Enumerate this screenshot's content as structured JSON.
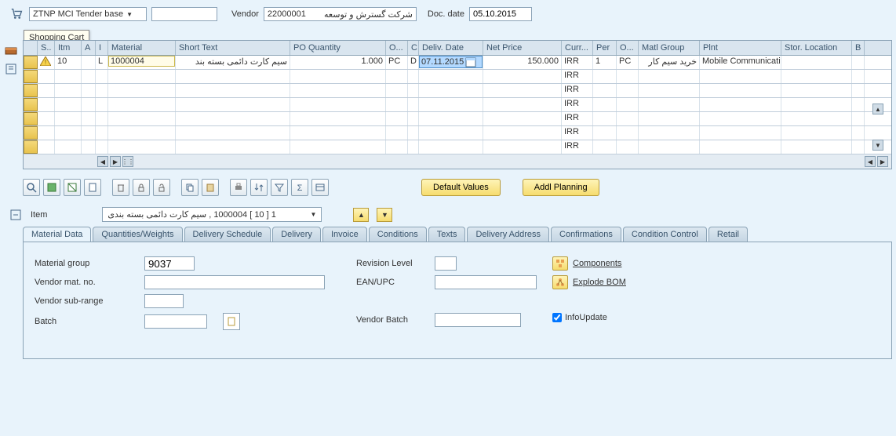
{
  "header": {
    "doc_type": "ZTNP MCI Tender base",
    "doc_type_value": "",
    "vendor_label": "Vendor",
    "vendor_code": "22000001",
    "vendor_name": "شرکت گسترش و توسعه",
    "doc_date_label": "Doc. date",
    "doc_date": "05.10.2015",
    "tooltip": "Shopping Cart"
  },
  "table": {
    "cols": {
      "status": "S..",
      "itm": "Itm",
      "a": "A",
      "i": "I",
      "material": "Material",
      "short_text": "Short Text",
      "po_qty": "PO Quantity",
      "oun": "O...",
      "c": "C",
      "deliv_date": "Deliv. Date",
      "net_price": "Net Price",
      "curr": "Curr...",
      "per": "Per",
      "opu": "O...",
      "matl_group": "Matl Group",
      "plnt": "Plnt",
      "stor_loc": "Stor. Location",
      "b": "B"
    },
    "rows": [
      {
        "itm": "10",
        "i": "L",
        "material": "1000004",
        "short_text": "سیم کارت دائمی بسته بند",
        "po_qty": "1.000",
        "oun": "PC",
        "c": "D",
        "deliv_date": "07.11.2015",
        "net_price": "150.000",
        "curr": "IRR",
        "per": "1",
        "opu": "PC",
        "matl_group": "خرید سیم کار",
        "plnt": "Mobile Communicati"
      },
      {
        "curr": "IRR"
      },
      {
        "curr": "IRR"
      },
      {
        "curr": "IRR"
      },
      {
        "curr": "IRR"
      },
      {
        "curr": "IRR"
      },
      {
        "curr": "IRR"
      }
    ]
  },
  "buttons": {
    "default_values": "Default Values",
    "addl_planning": "Addl Planning"
  },
  "item_section": {
    "label": "Item",
    "dropdown": "1 [ 10 ] 1000004 , سیم کارت دائمی بسته بندی"
  },
  "tabs": {
    "material_data": "Material Data",
    "quantities_weights": "Quantities/Weights",
    "delivery_schedule": "Delivery Schedule",
    "delivery": "Delivery",
    "invoice": "Invoice",
    "conditions": "Conditions",
    "texts": "Texts",
    "delivery_address": "Delivery Address",
    "confirmations": "Confirmations",
    "condition_control": "Condition Control",
    "retail": "Retail"
  },
  "material_data": {
    "material_group_label": "Material group",
    "material_group": "9037",
    "vendor_mat_label": "Vendor mat. no.",
    "vendor_mat": "",
    "vendor_sub_label": "Vendor sub-range",
    "vendor_sub": "",
    "batch_label": "Batch",
    "batch": "",
    "revision_label": "Revision Level",
    "revision": "",
    "ean_label": "EAN/UPC",
    "ean": "",
    "vendor_batch_label": "Vendor Batch",
    "vendor_batch": "",
    "components": "Components",
    "explode_bom": "Explode BOM",
    "info_update": "InfoUpdate"
  }
}
